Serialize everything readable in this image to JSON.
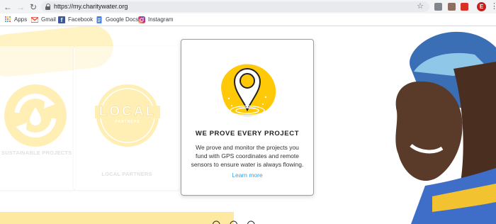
{
  "browser": {
    "url": "https://my.charitywater.org",
    "profile_initial": "E",
    "bookmarks": [
      {
        "label": "Apps",
        "icon": "apps-grid-icon"
      },
      {
        "label": "Gmail",
        "icon": "gmail-icon"
      },
      {
        "label": "Facebook",
        "icon": "facebook-icon"
      },
      {
        "label": "Google Docs",
        "icon": "google-docs-icon"
      },
      {
        "label": "Instagram",
        "icon": "instagram-icon"
      }
    ]
  },
  "cards": {
    "sustainable": {
      "label": "SUSTAINABLE PROJECTS",
      "icon": "recycle-water-icon"
    },
    "local": {
      "label": "LOCAL PARTNERS",
      "badge_title": "LOCAL",
      "badge_subtitle": "PARTNERS",
      "icon": "local-partners-badge-icon"
    },
    "prove": {
      "title": "WE PROVE EVERY PROJECT",
      "body": "We prove and monitor the projects you fund with GPS coordinates and remote sensors to ensure water is always flowing.",
      "link": "Learn more",
      "icon": "map-pin-icon"
    }
  },
  "colors": {
    "accent_yellow": "#ffc907",
    "link_blue": "#2fa4e7"
  }
}
